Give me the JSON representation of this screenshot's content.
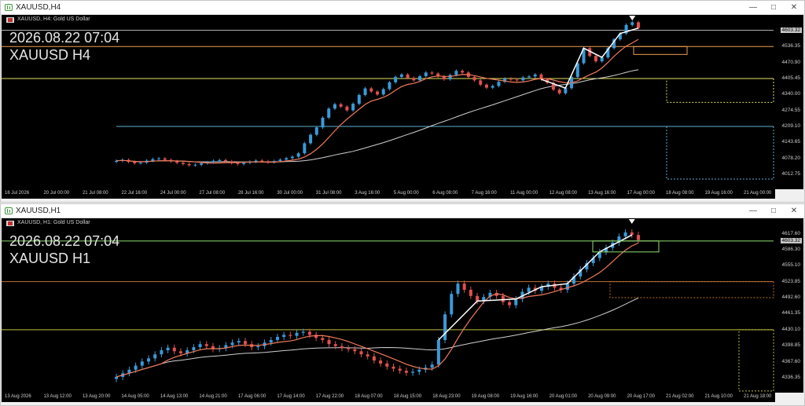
{
  "windows": [
    {
      "id": "h4",
      "title": "XAUUSD,H4",
      "symbol_line": "XAUUSD, H4:  Gold US Dollar",
      "datetime": "2026.08.22 07:04",
      "symbol_tf": "XAUUSD H4",
      "price_labels": [
        "4603.32",
        "4536.35",
        "4470.90",
        "4405.45",
        "4340.00",
        "4274.55",
        "4209.10",
        "4143.65",
        "4078.20",
        "4012.75"
      ],
      "current_price": "4603.32",
      "time_labels": [
        "16 Jul 2026",
        "20 Jul 00:00",
        "21 Jul 08:00",
        "22 Jul 16:00",
        "24 Jul 00:00",
        "27 Jul 08:00",
        "28 Jul 16:00",
        "30 Jul 00:00",
        "31 Jul 08:00",
        "3 Aug 16:00",
        "5 Aug 00:00",
        "6 Aug 08:00",
        "7 Aug 16:00",
        "11 Aug 00:00",
        "12 Aug 08:00",
        "13 Aug 16:00",
        "17 Aug 00:00",
        "18 Aug 08:00",
        "19 Aug 16:00",
        "21 Aug 00:00"
      ],
      "closes": [
        4068,
        4072,
        4064,
        4058,
        4061,
        4069,
        4075,
        4078,
        4072,
        4066,
        4060,
        4055,
        4050,
        4052,
        4058,
        4062,
        4068,
        4071,
        4066,
        4059,
        4055,
        4060,
        4064,
        4069,
        4066,
        4062,
        4067,
        4073,
        4079,
        4085,
        4099,
        4140,
        4175,
        4205,
        4245,
        4282,
        4300,
        4290,
        4275,
        4302,
        4338,
        4365,
        4352,
        4340,
        4362,
        4390,
        4412,
        4422,
        4408,
        4398,
        4415,
        4430,
        4426,
        4414,
        4402,
        4420,
        4437,
        4430,
        4412,
        4398,
        4380,
        4368,
        4375,
        4392,
        4405,
        4401,
        4398,
        4410,
        4414,
        4422,
        4402,
        4388,
        4360,
        4345,
        4366,
        4412,
        4468,
        4530,
        4498,
        4476,
        4492,
        4530,
        4566,
        4590,
        4625,
        4636,
        4612
      ],
      "colors": {
        "up": "#3a9ad9",
        "down": "#e05050",
        "ma_fast": "#f07a5a",
        "ma_slow": "#d0d0d0",
        "line_orange": "#f0a050",
        "line_yellow": "#e0e060",
        "line_cyan": "#60b0d0"
      }
    },
    {
      "id": "h1",
      "title": "XAUUSD,H1",
      "symbol_line": "XAUUSD, H1:  Gold US Dollar",
      "datetime": "2026.08.22 07:04",
      "symbol_tf": "XAUUSD H1",
      "price_labels": [
        "4617.60",
        "4603.32",
        "4586.30",
        "4555.10",
        "4523.85",
        "4492.60",
        "4461.35",
        "4430.10",
        "4398.85",
        "4367.60",
        "4336.35"
      ],
      "current_price": "4603.32",
      "time_labels": [
        "13 Aug 2026",
        "13 Aug 12:00",
        "13 Aug 20:00",
        "14 Aug 05:00",
        "14 Aug 13:00",
        "14 Aug 21:00",
        "17 Aug 06:00",
        "17 Aug 14:00",
        "17 Aug 22:00",
        "18 Aug 07:00",
        "18 Aug 15:00",
        "18 Aug 23:00",
        "19 Aug 08:00",
        "19 Aug 16:00",
        "20 Aug 01:00",
        "20 Aug 09:00",
        "20 Aug 17:00",
        "21 Aug 02:00",
        "21 Aug 10:00",
        "21 Aug 18:00"
      ],
      "closes": [
        4338,
        4345,
        4352,
        4360,
        4368,
        4374,
        4382,
        4390,
        4395,
        4388,
        4384,
        4390,
        4396,
        4402,
        4398,
        4392,
        4394,
        4400,
        4405,
        4408,
        4402,
        4396,
        4398,
        4405,
        4410,
        4416,
        4420,
        4418,
        4424,
        4426,
        4420,
        4414,
        4410,
        4402,
        4398,
        4394,
        4392,
        4388,
        4382,
        4378,
        4370,
        4364,
        4358,
        4354,
        4350,
        4346,
        4348,
        4352,
        4356,
        4362,
        4410,
        4460,
        4500,
        4520,
        4508,
        4496,
        4486,
        4494,
        4502,
        4496,
        4484,
        4478,
        4490,
        4504,
        4512,
        4506,
        4514,
        4520,
        4512,
        4508,
        4520,
        4534,
        4548,
        4560,
        4570,
        4582,
        4590,
        4600,
        4612,
        4620,
        4615,
        4605
      ],
      "colors": {
        "up": "#3a9ad9",
        "down": "#e05050",
        "ma_fast": "#f07a5a",
        "ma_slow": "#d0d0d0",
        "line_green": "#90e070",
        "line_orange": "#c07030",
        "line_yellow": "#c0c040"
      }
    }
  ]
}
